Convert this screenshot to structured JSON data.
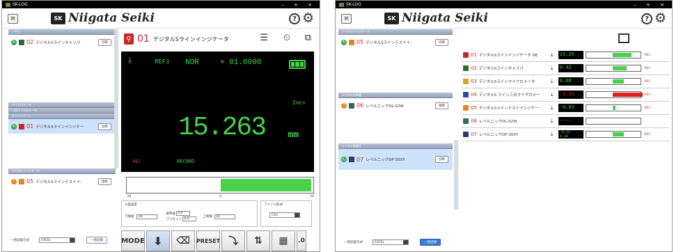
{
  "app": {
    "title": "SK-LOG",
    "brand": "Niigata Seiki",
    "logo_mark": "SK",
    "window_controls": "– + ×"
  },
  "colors": {
    "accent": "#47d24a",
    "danger": "#c62828",
    "selection": "#cde2fb"
  },
  "left": {
    "sections": [
      "ノギス",
      "マイクロメータ",
      "三点マイクロメータ",
      "ダイヤルゲージ",
      "デジタルインジケータ"
    ],
    "device_02": {
      "num": "02",
      "name": "デジタルSラインキャリパ",
      "btn": "切断"
    },
    "device_01": {
      "num": "01",
      "name": "デジタルSラインインジケー",
      "btn": "切断"
    },
    "device_05": {
      "num": "05",
      "name": "デジタルSラインテストイ:",
      "btn": "接続"
    },
    "record_mode_label": "一括記録方式",
    "record_mode_value": "EXCEL",
    "record_btn": "一括記録"
  },
  "detail": {
    "num": "01",
    "name": "デジタルSラインインジケータ",
    "ref": "REF1",
    "nor": "NOR",
    "mult": "× 01.0000",
    "value": "15.263",
    "unit": "mm",
    "inc": "Inc+",
    "rec": "REC",
    "record": "RECORD",
    "level": 0.62,
    "scale": [
      "-16",
      "0",
      "16"
    ],
    "settings_title": "公差設定",
    "lower_label": "下限値",
    "lower_val": "-16",
    "base_label": "基準値",
    "base_val": "0.0",
    "preset_label": "プリセット",
    "preset_val": "0.0",
    "upper_label": "上限値",
    "upper_val": "16",
    "format_title": "ファイル形式",
    "format_val": "CSV",
    "toolbar": {
      "mode": "MODE",
      "preset": "PRESET"
    }
  },
  "right": {
    "sections": [
      "デジタルインジケータ",
      "デジタル水準器",
      "デジタル角度計"
    ],
    "side_05": {
      "num": "05",
      "name": "デジタルSラインテストイ:",
      "btn": "切断"
    },
    "side_06": {
      "num": "06",
      "name": "レベルニックDL-S2W",
      "btn": "接続"
    },
    "side_07": {
      "num": "07",
      "name": "レベルニックDP-30XY",
      "btn": "切断"
    },
    "rows": [
      {
        "num": "01",
        "name": "デジタルSラインインジケータ DE",
        "value": "15.26",
        "fill": 0.35,
        "color": "#47d24a",
        "rec": "REC"
      },
      {
        "num": "02",
        "name": "デジタルSラインキャリパ",
        "value": "0.42",
        "fill": 0.25,
        "color": "#47d24a",
        "rec": "REC"
      },
      {
        "num": "03",
        "name": "デジタルSラインマイクロメータ",
        "value": "0.68",
        "fill": 0.2,
        "color": "#47d24a",
        "rec": "REC"
      },
      {
        "num": "04",
        "name": "デジタルS ライン三点マイクロメー",
        "value": "-1.31",
        "fill": 0.55,
        "color": "#e02020",
        "rec": "REC"
      },
      {
        "num": "05",
        "name": "デジタルSラインテストインジケー",
        "value": "-0.03",
        "fill": 0.05,
        "color": "#47d24a",
        "rec": "REC"
      },
      {
        "num": "06",
        "name": "レベルニックDL-S2W",
        "value": "----",
        "fill": 0,
        "color": "#47d24a",
        "rec": ""
      },
      {
        "num": "07",
        "name": "レベルニックDP-30XY",
        "value": "-0.11",
        "value2": "0.30",
        "fill": 0.2,
        "color": "#47d24a",
        "rec": "REC"
      }
    ],
    "record_mode_label": "一括記録方式",
    "record_mode_value": "EXCEL",
    "record_btn": "一括記録"
  }
}
